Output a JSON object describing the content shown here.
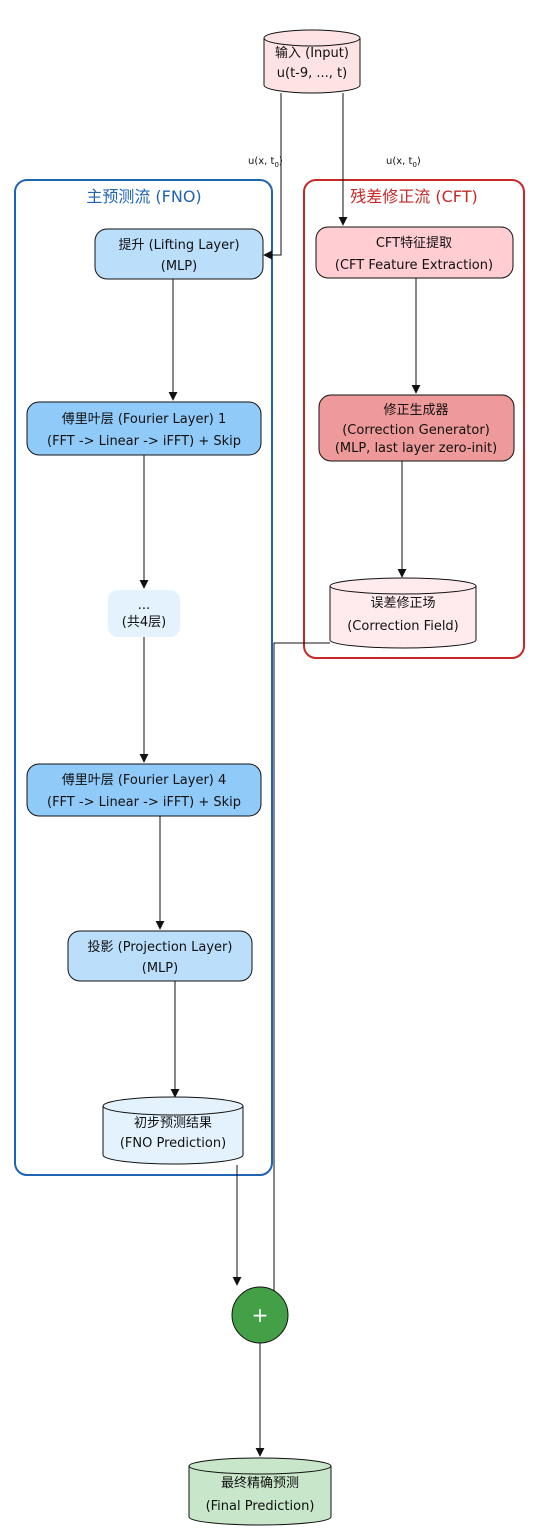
{
  "colors": {
    "fno_border": "#1f63b3",
    "cft_border": "#c62828",
    "input_fill": "#fde3e3",
    "blue_fill": "#bbdefb",
    "blue_fill_dark": "#90caf9",
    "blue_light": "#e3f2fd",
    "red_fill": "#ffcdd2",
    "red_fill_dark": "#ef9a9a",
    "red_light": "#ffebee",
    "green_fill": "#c8e6c9",
    "plus_fill": "#43a047"
  },
  "clusters": {
    "fno": {
      "title": "主预测流 (FNO)"
    },
    "cft": {
      "title": "残差修正流 (CFT)"
    }
  },
  "nodes": {
    "input": {
      "line1": "输入 (Input)",
      "line2": "u(t-9, ..., t)"
    },
    "lifting": {
      "line1": "提升 (Lifting Layer)",
      "line2": "(MLP)"
    },
    "fourier1": {
      "line1": "傅里叶层 (Fourier Layer) 1",
      "line2": "(FFT -> Linear -> iFFT) + Skip"
    },
    "ellipsis": {
      "line1": "...",
      "line2": "(共4层)"
    },
    "fourier4": {
      "line1": "傅里叶层 (Fourier Layer) 4",
      "line2": "(FFT -> Linear -> iFFT) + Skip"
    },
    "projection": {
      "line1": "投影 (Projection Layer)",
      "line2": "(MLP)"
    },
    "fno_pred": {
      "line1": "初步预测结果",
      "line2": "(FNO Prediction)"
    },
    "cft_feat": {
      "line1": "CFT特征提取",
      "line2": "(CFT Feature Extraction)"
    },
    "corr_gen": {
      "line1": "修正生成器",
      "line2": "(Correction Generator)",
      "line3": "(MLP, last layer zero-init)"
    },
    "corr_field": {
      "line1": "误差修正场",
      "line2": "(Correction Field)"
    },
    "plus": {
      "symbol": "+"
    },
    "final": {
      "line1": "最终精确预测",
      "line2": "(Final Prediction)"
    }
  },
  "edges": {
    "input_to_lifting": {
      "label": "u(x, t",
      "sub": "0",
      "close": ")"
    },
    "input_to_cft": {
      "label": "u(x, t",
      "sub": "0",
      "close": ")"
    }
  }
}
